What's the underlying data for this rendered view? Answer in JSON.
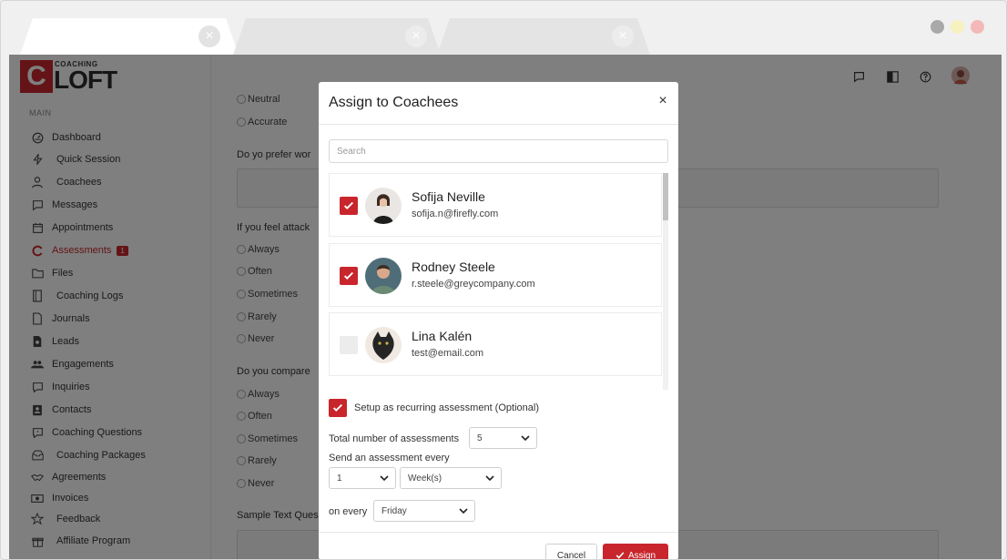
{
  "browser": {
    "window_dots": [
      "#a9a9a9",
      "#f7f1c0",
      "#f4b8b8"
    ]
  },
  "brand": {
    "logo_letter": "C",
    "small_text": "COACHING",
    "big_text": "LOFT",
    "accent_color": "#c8262c"
  },
  "sidebar": {
    "section_label": "MAIN",
    "items": [
      {
        "label": "Dashboard",
        "icon": "dashboard-icon"
      },
      {
        "label": "Quick Session",
        "icon": "bolt-icon"
      },
      {
        "label": "Coachees",
        "icon": "users-icon"
      },
      {
        "label": "Messages",
        "icon": "message-icon"
      },
      {
        "label": "Appointments",
        "icon": "calendar-icon"
      },
      {
        "label": "Assessments",
        "icon": "assessment-icon",
        "badge": "1",
        "active": true
      },
      {
        "label": "Files",
        "icon": "folder-icon"
      },
      {
        "label": "Coaching Logs",
        "icon": "book-icon"
      },
      {
        "label": "Journals",
        "icon": "journal-icon"
      },
      {
        "label": "Leads",
        "icon": "leads-icon"
      },
      {
        "label": "Engagements",
        "icon": "group-icon"
      },
      {
        "label": "Inquiries",
        "icon": "inquiry-icon"
      },
      {
        "label": "Contacts",
        "icon": "contacts-icon"
      },
      {
        "label": "Coaching Questions",
        "icon": "question-bubble-icon"
      },
      {
        "label": "Coaching Packages",
        "icon": "package-icon"
      },
      {
        "label": "Agreements",
        "icon": "handshake-icon"
      },
      {
        "label": "Invoices",
        "icon": "invoice-icon"
      },
      {
        "label": "Feedback",
        "icon": "star-icon"
      },
      {
        "label": "Affiliate Program",
        "icon": "gift-icon"
      }
    ]
  },
  "topbar": {
    "icons": [
      "chat-icon",
      "contrast-icon",
      "help-icon",
      "user-avatar"
    ]
  },
  "form": {
    "partial_option": "Neutral",
    "option_accurate": "Accurate",
    "q1": "Do yo prefer wor",
    "q2": "If you feel attack",
    "options_a": [
      "Always",
      "Often",
      "Sometimes",
      "Rarely",
      "Never"
    ],
    "q3": "Do you compare",
    "options_b": [
      "Always",
      "Often",
      "Sometimes",
      "Rarely",
      "Never"
    ],
    "q4": "Sample Text Ques"
  },
  "modal": {
    "title": "Assign to Coachees",
    "close": "×",
    "search_placeholder": "Search",
    "coachees": [
      {
        "name": "Sofija Neville",
        "email": "sofija.n@firefly.com",
        "checked": true
      },
      {
        "name": "Rodney Steele",
        "email": "r.steele@greycompany.com",
        "checked": true
      },
      {
        "name": "Lina Kalén",
        "email": "test@email.com",
        "checked": false
      }
    ],
    "recurring_label": "Setup as recurring assessment (Optional)",
    "recurring_checked": true,
    "total_label": "Total number of assessments",
    "total_value": "5",
    "send_label": "Send an assessment every",
    "interval_value": "1",
    "interval_unit": "Week(s)",
    "on_every_label": "on every",
    "day_value": "Friday",
    "cancel_label": "Cancel",
    "assign_label": "Assign"
  }
}
